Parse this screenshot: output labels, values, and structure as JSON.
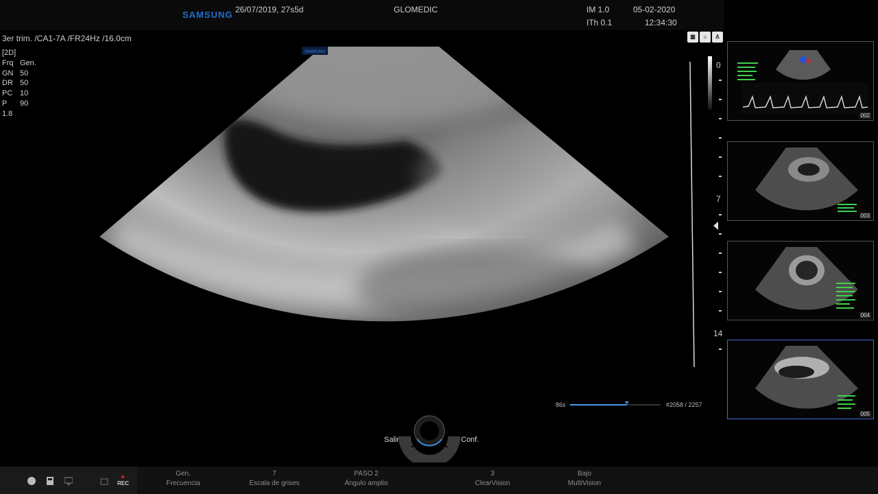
{
  "header": {
    "brand": "SAMSUNG",
    "patient_info": "26/07/2019, 27s5d",
    "hospital": "GLOMEDIC",
    "im": "IM  1.0",
    "ith": "ITh  0.1",
    "date": "05-02-2020",
    "time": "12:34:30"
  },
  "probe": {
    "line": "3er trim. /CA1-7A /FR24Hz /16.0cm",
    "logo": "SAMSUNG"
  },
  "params": [
    {
      "k": "[2D]",
      "v": ""
    },
    {
      "k": "Frq",
      "v": "Gen."
    },
    {
      "k": "GN",
      "v": "50"
    },
    {
      "k": "DR",
      "v": "50"
    },
    {
      "k": "PC",
      "v": "10"
    },
    {
      "k": "P",
      "v": "90"
    },
    {
      "k": "1.8",
      "v": ""
    }
  ],
  "depth_scale": {
    "top": "0",
    "mid": "7",
    "bottom": "14"
  },
  "top_icons": [
    "bar-icon",
    "scan-icon",
    "person-icon"
  ],
  "thumbnails": [
    {
      "label": "002",
      "type": "doppler"
    },
    {
      "label": "003",
      "type": "bmode"
    },
    {
      "label": "004",
      "type": "bmode"
    },
    {
      "label": "005",
      "type": "bmode"
    }
  ],
  "cine": {
    "time": "86s",
    "frames": "#2058 / 2257",
    "position": 0.63
  },
  "trackball": {
    "left": "Salir",
    "right": "Conf."
  },
  "softkeys": [
    {
      "top": "Gen.",
      "bottom": "Frecuencia"
    },
    {
      "top": "7",
      "bottom": "Escala de grises"
    },
    {
      "top": "PASO 2",
      "bottom": "Ángulo amplio"
    },
    {
      "top": "3",
      "bottom": "ClearVision"
    },
    {
      "top": "Bajo",
      "bottom": "MultiVision"
    }
  ],
  "rec_label": "REC",
  "colors": {
    "brand": "#1f6fd1",
    "accent": "#4a9ae8",
    "rec": "#e02020"
  }
}
